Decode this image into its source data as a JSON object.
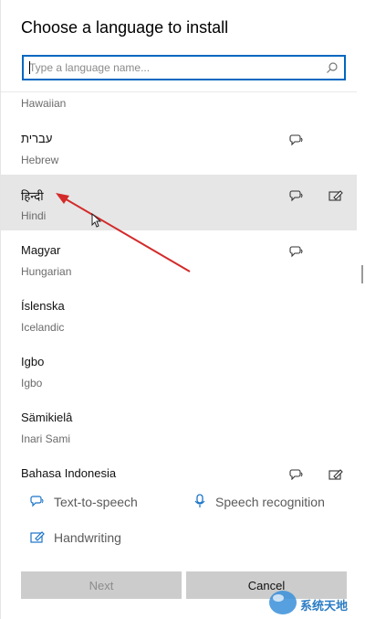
{
  "dialog": {
    "title": "Choose a language to install",
    "search": {
      "placeholder": "Type a language name...",
      "value": ""
    }
  },
  "languages": {
    "partial_label": "Hawaiian",
    "items": [
      {
        "native": "עברית",
        "english": "Hebrew",
        "features": [
          "text-to-speech"
        ]
      },
      {
        "native": "हिन्दी",
        "english": "Hindi",
        "features": [
          "text-to-speech",
          "handwriting"
        ],
        "selected": true
      },
      {
        "native": "Magyar",
        "english": "Hungarian",
        "features": [
          "text-to-speech"
        ]
      },
      {
        "native": "Íslenska",
        "english": "Icelandic",
        "features": []
      },
      {
        "native": "Igbo",
        "english": "Igbo",
        "features": []
      },
      {
        "native": "Sämikielâ",
        "english": "Inari Sami",
        "features": []
      },
      {
        "native": "Bahasa Indonesia",
        "english": "",
        "features": [
          "text-to-speech",
          "handwriting"
        ]
      }
    ]
  },
  "legend": {
    "tts": "Text-to-speech",
    "speech": "Speech recognition",
    "handwriting": "Handwriting"
  },
  "buttons": {
    "next": "Next",
    "cancel": "Cancel"
  },
  "watermark": {
    "text": "系统天地"
  },
  "colors": {
    "accent": "#0067c0",
    "annotation_arrow": "#d42a2a",
    "selected_row": "#e6e6e6"
  },
  "icons": {
    "tts": "text-to-speech-icon",
    "handwriting": "handwriting-icon",
    "speech": "microphone-icon",
    "search": "search-icon"
  }
}
